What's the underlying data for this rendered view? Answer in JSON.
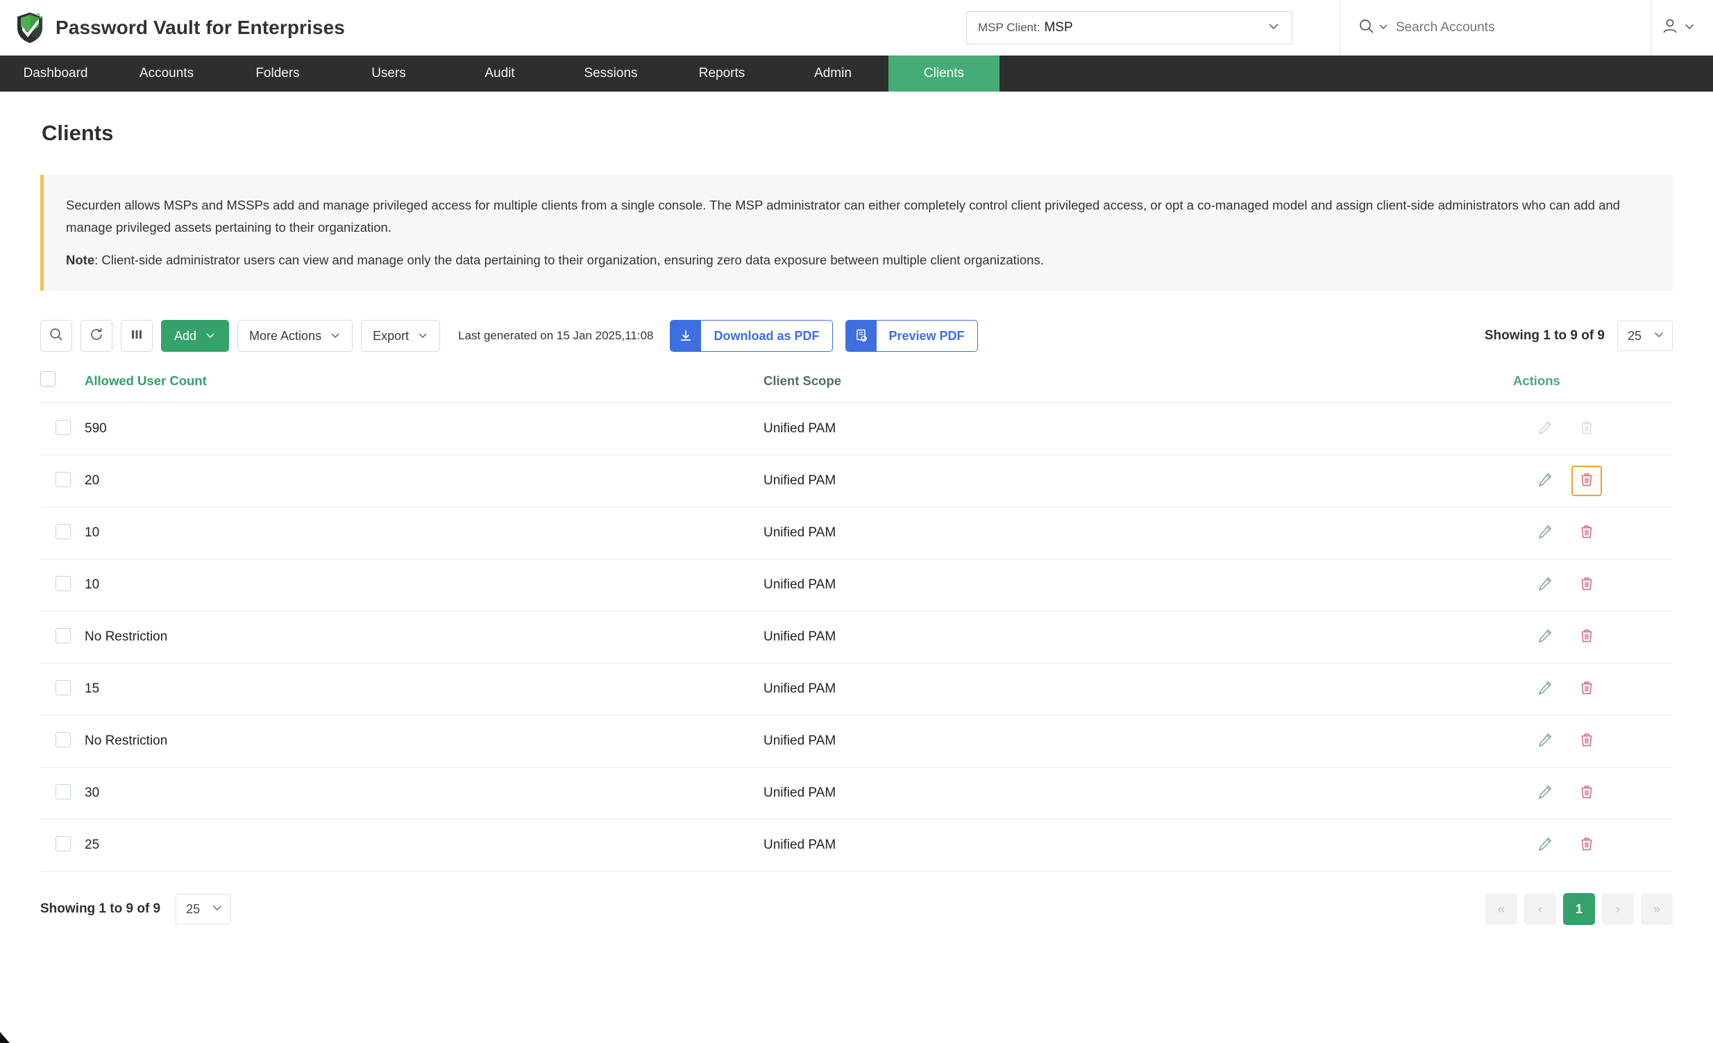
{
  "header": {
    "brand_title": "Password Vault for Enterprises",
    "logo_icon": "shield-check-icon",
    "msp_select": {
      "label": "MSP Client:",
      "value": "MSP",
      "chevron_icon": "chevron-down-icon"
    },
    "search": {
      "icon": "search-icon",
      "chevron_icon": "chevron-down-icon",
      "placeholder": "Search Accounts",
      "value": ""
    },
    "user_menu": {
      "icon": "user-icon",
      "chevron_icon": "chevron-down-icon"
    }
  },
  "nav": {
    "items": [
      {
        "label": "Dashboard",
        "active": false
      },
      {
        "label": "Accounts",
        "active": false
      },
      {
        "label": "Folders",
        "active": false
      },
      {
        "label": "Users",
        "active": false
      },
      {
        "label": "Audit",
        "active": false
      },
      {
        "label": "Sessions",
        "active": false
      },
      {
        "label": "Reports",
        "active": false
      },
      {
        "label": "Admin",
        "active": false
      },
      {
        "label": "Clients",
        "active": true
      }
    ],
    "active_color": "#45ac78",
    "background": "#2e2e2e"
  },
  "page": {
    "title": "Clients"
  },
  "banner": {
    "accent_color": "#f2c14e",
    "paragraph1": "Securden allows MSPs and MSSPs add and manage privileged access for multiple clients from a single console. The MSP administrator can either completely control client privileged access, or opt a co-managed model and assign client-side administrators who can add and manage privileged assets pertaining to their organization.",
    "note_label": "Note",
    "note_text": ": Client-side administrator users can view and manage only the data pertaining to their organization, ensuring zero data exposure between multiple client organizations."
  },
  "toolbar": {
    "search_icon": "search-icon",
    "refresh_icon": "refresh-icon",
    "columns_icon": "columns-icon",
    "add_label": "Add",
    "more_actions_label": "More Actions",
    "export_label": "Export",
    "last_generated": "Last generated on 15 Jan 2025,11:08",
    "download_pdf_label": "Download as PDF",
    "download_pdf_icon": "download-icon",
    "preview_pdf_label": "Preview PDF",
    "preview_pdf_icon": "document-preview-icon",
    "showing_text": "Showing 1 to 9 of 9",
    "page_size": "25",
    "primary_color": "#35a16b",
    "pdf_button_color": "#3d6fe0"
  },
  "table": {
    "columns": [
      {
        "label": "Allowed User Count",
        "sorted": true
      },
      {
        "label": "Client Scope",
        "sorted": false
      },
      {
        "label": "Actions",
        "sorted": false
      }
    ],
    "header_checkbox": "select-all-checkbox",
    "rows": [
      {
        "allowed_user_count": "590",
        "client_scope": "Unified PAM",
        "edit_icon": "pencil-icon",
        "delete_icon": "trash-icon",
        "delete_highlighted": false,
        "delete_disabled": true
      },
      {
        "allowed_user_count": "20",
        "client_scope": "Unified PAM",
        "edit_icon": "pencil-icon",
        "delete_icon": "trash-icon",
        "delete_highlighted": true,
        "delete_disabled": false
      },
      {
        "allowed_user_count": "10",
        "client_scope": "Unified PAM",
        "edit_icon": "pencil-icon",
        "delete_icon": "trash-icon",
        "delete_highlighted": false,
        "delete_disabled": false
      },
      {
        "allowed_user_count": "10",
        "client_scope": "Unified PAM",
        "edit_icon": "pencil-icon",
        "delete_icon": "trash-icon",
        "delete_highlighted": false,
        "delete_disabled": false
      },
      {
        "allowed_user_count": "No Restriction",
        "client_scope": "Unified PAM",
        "edit_icon": "pencil-icon",
        "delete_icon": "trash-icon",
        "delete_highlighted": false,
        "delete_disabled": false
      },
      {
        "allowed_user_count": "15",
        "client_scope": "Unified PAM",
        "edit_icon": "pencil-icon",
        "delete_icon": "trash-icon",
        "delete_highlighted": false,
        "delete_disabled": false
      },
      {
        "allowed_user_count": "No Restriction",
        "client_scope": "Unified PAM",
        "edit_icon": "pencil-icon",
        "delete_icon": "trash-icon",
        "delete_highlighted": false,
        "delete_disabled": false
      },
      {
        "allowed_user_count": "30",
        "client_scope": "Unified PAM",
        "edit_icon": "pencil-icon",
        "delete_icon": "trash-icon",
        "delete_highlighted": false,
        "delete_disabled": false
      },
      {
        "allowed_user_count": "25",
        "client_scope": "Unified PAM",
        "edit_icon": "pencil-icon",
        "delete_icon": "trash-icon",
        "delete_highlighted": false,
        "delete_disabled": false
      }
    ],
    "highlight_color": "#e8a33d"
  },
  "footer": {
    "showing_text": "Showing 1 to 9 of 9",
    "page_size": "25",
    "pager": [
      {
        "label": "«",
        "name": "first-page-button",
        "active": false
      },
      {
        "label": "‹",
        "name": "prev-page-button",
        "active": false
      },
      {
        "label": "1",
        "name": "page-1-button",
        "active": true
      },
      {
        "label": "›",
        "name": "next-page-button",
        "active": false
      },
      {
        "label": "»",
        "name": "last-page-button",
        "active": false
      }
    ]
  }
}
